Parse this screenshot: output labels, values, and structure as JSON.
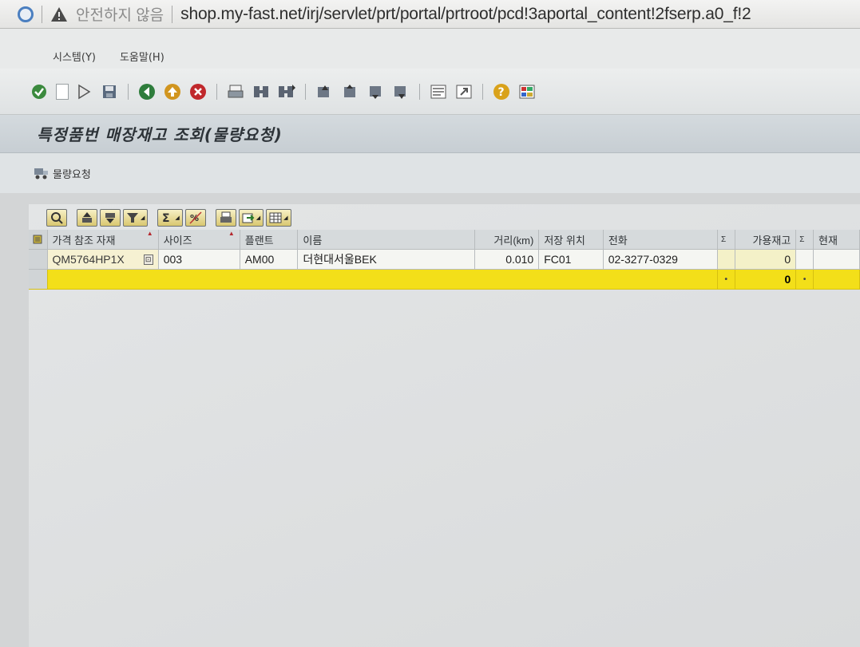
{
  "browser": {
    "security_warning": "안전하지 않음",
    "url": "shop.my-fast.net/irj/servlet/prt/portal/prtroot/pcd!3aportal_content!2fserp.a0_f!2"
  },
  "menu": {
    "items": [
      "시스템(Y)",
      "도움말(H)"
    ]
  },
  "toolbar": {
    "icons": [
      "check-icon",
      "execute-icon",
      "save-icon",
      "back-icon",
      "exit-icon",
      "cancel-icon",
      "print-icon",
      "find-icon",
      "find-next-icon",
      "first-page-icon",
      "prev-page-icon",
      "next-page-icon",
      "last-page-icon",
      "new-session-icon",
      "shortcut-icon",
      "help-icon",
      "layout-icon"
    ]
  },
  "title": "특정품번 매장재고 조회(물량요청)",
  "app_toolbar": {
    "request_label": "물량요청"
  },
  "grid": {
    "columns": [
      {
        "key": "material",
        "label": "가격 참조 자재"
      },
      {
        "key": "size",
        "label": "사이즈"
      },
      {
        "key": "plant",
        "label": "플랜트"
      },
      {
        "key": "name",
        "label": "이름"
      },
      {
        "key": "distance",
        "label": "거리(km)"
      },
      {
        "key": "storage",
        "label": "저장 위치"
      },
      {
        "key": "phone",
        "label": "전화"
      },
      {
        "key": "sigma1",
        "label": "Σ"
      },
      {
        "key": "available",
        "label": "가용재고"
      },
      {
        "key": "sigma2",
        "label": "Σ"
      },
      {
        "key": "current",
        "label": "현재"
      }
    ],
    "rows": [
      {
        "material": "QM5764HP1X",
        "size": "003",
        "plant": "AM00",
        "name": "더현대서울BEK",
        "distance": "0.010",
        "storage": "FC01",
        "phone": "02-3277-0329",
        "available": "0"
      }
    ],
    "total": {
      "available": "0"
    }
  },
  "colors": {
    "total_row": "#f3df19",
    "sum_cell": "#f4f1c8",
    "title_bg": "#cfd5da"
  }
}
